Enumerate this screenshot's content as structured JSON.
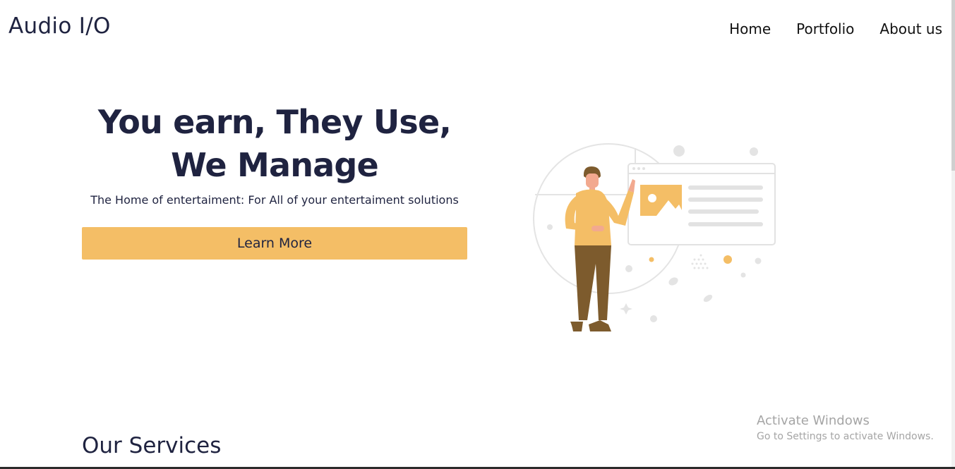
{
  "header": {
    "brand": "Audio I/O",
    "nav": [
      {
        "label": "Home"
      },
      {
        "label": "Portfolio"
      },
      {
        "label": "About us"
      }
    ]
  },
  "hero": {
    "title_line1": "You earn, They Use,",
    "title_line2": "We Manage",
    "subtitle": "The Home of entertaiment: For All of your entertaiment solutions",
    "cta_label": "Learn More",
    "illustration": "person-presenting-webpage-illustration"
  },
  "services": {
    "title": "Our Services"
  },
  "watermark": {
    "line1": "Activate Windows",
    "line2": "Go to Settings to activate Windows."
  },
  "colors": {
    "accent": "#f4be66",
    "text": "#1f2340",
    "illustration_brown": "#7d5b2d",
    "illustration_gray": "#e2e2e2"
  }
}
